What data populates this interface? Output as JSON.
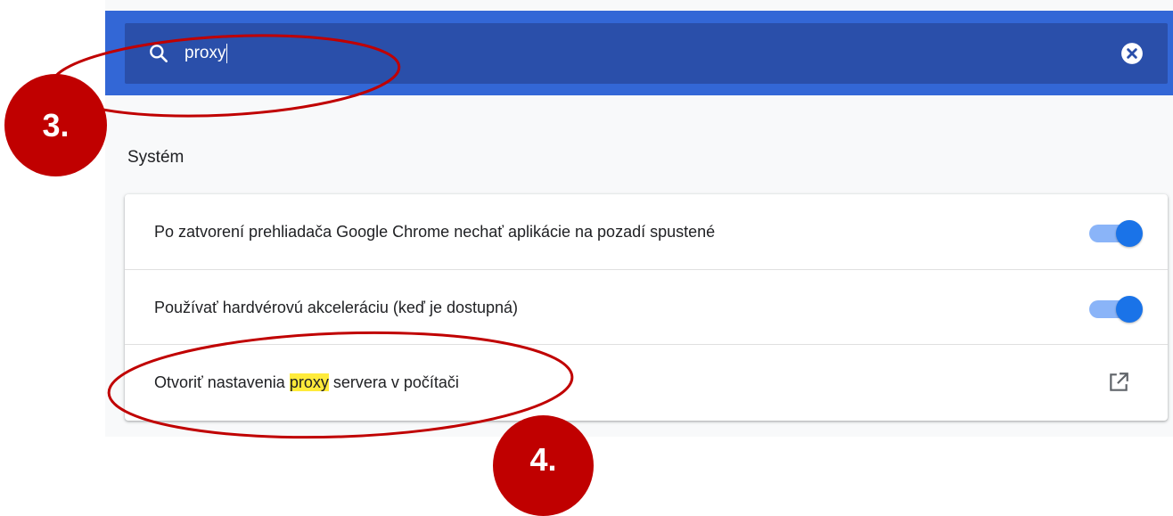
{
  "search": {
    "query": "proxy",
    "search_icon": "search-icon",
    "clear_icon": "close-circle-icon"
  },
  "section": {
    "title": "Systém"
  },
  "settings": [
    {
      "label": "Po zatvorení prehliadača Google Chrome nechať aplikácie na pozadí spustené",
      "control": "toggle",
      "enabled": true
    },
    {
      "label": "Používať hardvérovú akceleráciu (keď je dostupná)",
      "control": "toggle",
      "enabled": true
    },
    {
      "label_before": "Otvoriť nastavenia ",
      "label_highlight": "proxy",
      "label_after": " servera v počítači",
      "control": "external-link",
      "icon": "open-in-new-icon"
    }
  ],
  "annotations": {
    "step3": "3.",
    "step4": "4."
  },
  "colors": {
    "toolbar": "#3367d6",
    "search_field": "#2a4faa",
    "toggle_on": "#1a73e8",
    "highlight": "#ffeb3b",
    "annotation": "#c00000"
  }
}
